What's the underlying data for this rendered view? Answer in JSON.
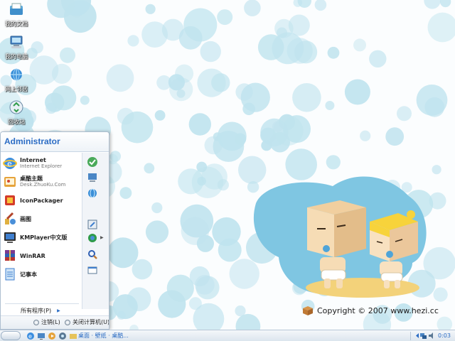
{
  "desktop": {
    "icons": [
      {
        "label": "我的文档",
        "icon": "documents-folder-icon"
      },
      {
        "label": "我的电脑",
        "icon": "computer-icon"
      },
      {
        "label": "网上邻居",
        "icon": "network-icon"
      },
      {
        "label": "回收站",
        "icon": "recycle-bin-icon"
      }
    ],
    "copyright": "Copyright © 2007  www.hezi.cc"
  },
  "start_menu": {
    "user": "Administrator",
    "items": [
      {
        "title": "Internet",
        "subtitle": "Internet Explorer",
        "icon": "internet-explorer-icon"
      },
      {
        "title": "桌酷主题",
        "subtitle": "Desk.ZhuoKu.Com",
        "icon": "theme-icon"
      },
      {
        "title": "IconPackager",
        "subtitle": "",
        "icon": "iconpackager-icon"
      },
      {
        "title": "画图",
        "subtitle": "",
        "icon": "paint-icon"
      },
      {
        "title": "KMPlayer中文版",
        "subtitle": "",
        "icon": "kmplayer-icon"
      },
      {
        "title": "WinRAR",
        "subtitle": "",
        "icon": "winrar-icon"
      },
      {
        "title": "记事本",
        "subtitle": "",
        "icon": "notepad-icon"
      }
    ],
    "all_programs": "所有程序(P)",
    "logoff": "注销(L)",
    "shutdown": "关闭计算机(U)"
  },
  "taskbar": {
    "task_label": "桌面 · 壁纸 · 桌酷...",
    "clock": "0:03"
  },
  "colors": {
    "bubble": "#bfe3ee",
    "accent": "#2b6cc4"
  }
}
